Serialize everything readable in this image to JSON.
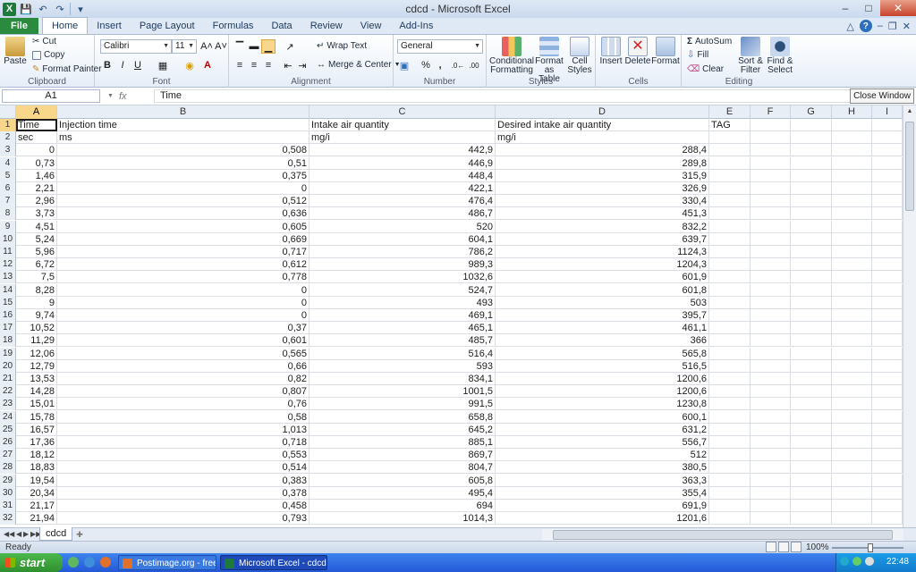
{
  "window": {
    "title": "cdcd  -  Microsoft Excel"
  },
  "tabs": [
    "File",
    "Home",
    "Insert",
    "Page Layout",
    "Formulas",
    "Data",
    "Review",
    "View",
    "Add-Ins"
  ],
  "ribbon": {
    "clipboard": {
      "label": "Clipboard",
      "paste": "Paste",
      "cut": "Cut",
      "copy": "Copy",
      "format_painter": "Format Painter"
    },
    "font": {
      "label": "Font",
      "name": "Calibri",
      "size": "11",
      "bold": "B",
      "italic": "I",
      "underline": "U"
    },
    "alignment": {
      "label": "Alignment",
      "wrap": "Wrap Text",
      "merge": "Merge & Center"
    },
    "number": {
      "label": "Number",
      "format": "General",
      "percent": "%",
      "comma": ","
    },
    "styles": {
      "label": "Styles",
      "conditional": "Conditional",
      "conditional2": "Formatting",
      "table": "Format",
      "table2": "as Table",
      "cell": "Cell",
      "cell2": "Styles"
    },
    "cells": {
      "label": "Cells",
      "insert": "Insert",
      "delete": "Delete",
      "format": "Format"
    },
    "editing": {
      "label": "Editing",
      "autosum": "AutoSum",
      "fill": "Fill",
      "clear": "Clear",
      "sort": "Sort &",
      "sort2": "Filter",
      "find": "Find &",
      "find2": "Select"
    }
  },
  "formula_bar": {
    "name_box": "A1",
    "fx": "fx",
    "content": "Time",
    "close_window": "Close Window"
  },
  "columns": [
    "A",
    "B",
    "C",
    "D",
    "E",
    "F",
    "G",
    "H",
    "I"
  ],
  "header_row": [
    "Time",
    "Injection time",
    "Intake air quantity",
    "Desired intake air quantity",
    "TAG"
  ],
  "unit_row": [
    "sec",
    "ms",
    "mg/i",
    "mg/i",
    ""
  ],
  "data_rows": [
    [
      "0",
      "0,508",
      "442,9",
      "288,4"
    ],
    [
      "0,73",
      "0,51",
      "446,9",
      "289,8"
    ],
    [
      "1,46",
      "0,375",
      "448,4",
      "315,9"
    ],
    [
      "2,21",
      "0",
      "422,1",
      "326,9"
    ],
    [
      "2,96",
      "0,512",
      "476,4",
      "330,4"
    ],
    [
      "3,73",
      "0,636",
      "486,7",
      "451,3"
    ],
    [
      "4,51",
      "0,605",
      "520",
      "832,2"
    ],
    [
      "5,24",
      "0,669",
      "604,1",
      "639,7"
    ],
    [
      "5,96",
      "0,717",
      "786,2",
      "1124,3"
    ],
    [
      "6,72",
      "0,612",
      "989,3",
      "1204,3"
    ],
    [
      "7,5",
      "0,778",
      "1032,6",
      "601,9"
    ],
    [
      "8,28",
      "0",
      "524,7",
      "601,8"
    ],
    [
      "9",
      "0",
      "493",
      "503"
    ],
    [
      "9,74",
      "0",
      "469,1",
      "395,7"
    ],
    [
      "10,52",
      "0,37",
      "465,1",
      "461,1"
    ],
    [
      "11,29",
      "0,601",
      "485,7",
      "366"
    ],
    [
      "12,06",
      "0,565",
      "516,4",
      "565,8"
    ],
    [
      "12,79",
      "0,66",
      "593",
      "516,5"
    ],
    [
      "13,53",
      "0,82",
      "834,1",
      "1200,6"
    ],
    [
      "14,28",
      "0,807",
      "1001,5",
      "1200,6"
    ],
    [
      "15,01",
      "0,76",
      "991,5",
      "1230,8"
    ],
    [
      "15,78",
      "0,58",
      "658,8",
      "600,1"
    ],
    [
      "16,57",
      "1,013",
      "645,2",
      "631,2"
    ],
    [
      "17,36",
      "0,718",
      "885,1",
      "556,7"
    ],
    [
      "18,12",
      "0,553",
      "869,7",
      "512"
    ],
    [
      "18,83",
      "0,514",
      "804,7",
      "380,5"
    ],
    [
      "19,54",
      "0,383",
      "605,8",
      "363,3"
    ],
    [
      "20,34",
      "0,378",
      "495,4",
      "355,4"
    ],
    [
      "21,17",
      "0,458",
      "694",
      "691,9"
    ],
    [
      "21,94",
      "0,793",
      "1014,3",
      "1201,6"
    ]
  ],
  "sheet_tab": "cdcd",
  "status": {
    "text": "Ready",
    "zoom": "100%"
  },
  "taskbar": {
    "start": "start",
    "task1": "Postimage.org - free i...",
    "task2": "Microsoft Excel - cdcd",
    "clock": "22:48"
  }
}
